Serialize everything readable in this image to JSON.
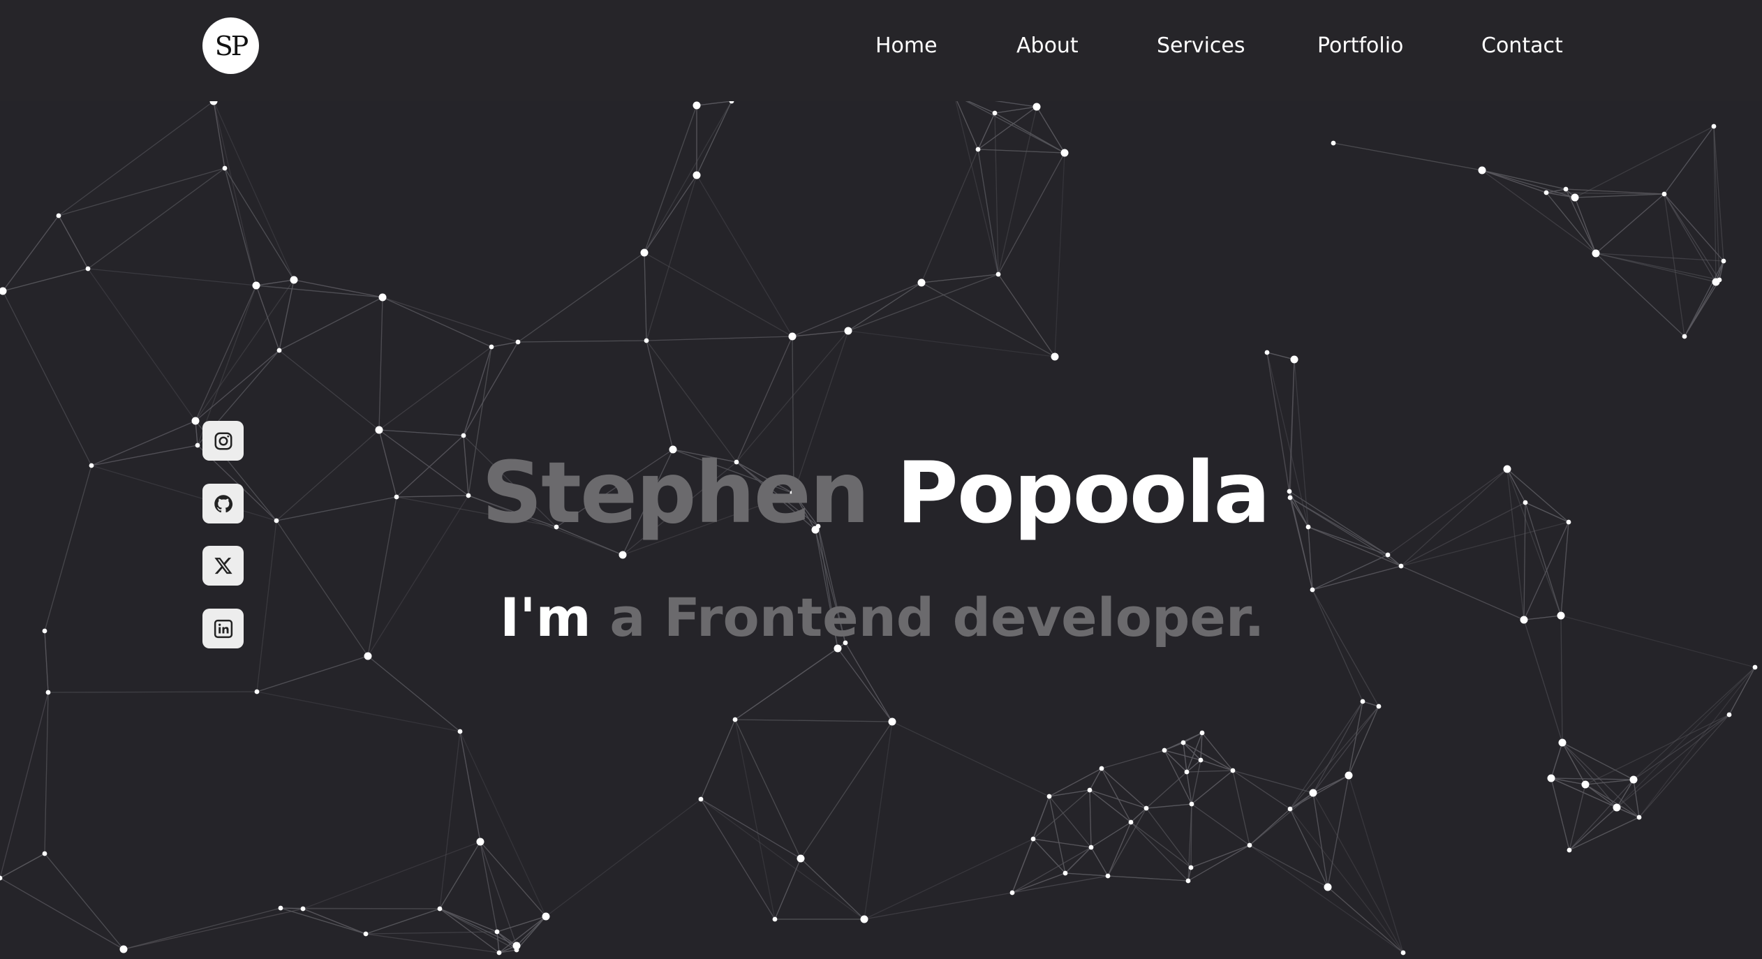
{
  "header": {
    "logo_text": "SP",
    "nav": [
      "Home",
      "About",
      "Services",
      "Portfolio",
      "Contact"
    ]
  },
  "hero": {
    "first_name": "Stephen",
    "last_name": "Popoola",
    "tagline_lead": "I'm",
    "tagline_role": "a Frontend developer."
  },
  "social": [
    {
      "name": "instagram-icon"
    },
    {
      "name": "github-icon"
    },
    {
      "name": "x-icon"
    },
    {
      "name": "linkedin-icon"
    }
  ],
  "colors": {
    "background": "#252429",
    "header": "#262529",
    "text_primary": "#ffffff",
    "text_muted": "#6b6a6d",
    "icon_tile": "#ededed",
    "network_node": "#ffffff",
    "network_line": "#5b5a60"
  }
}
